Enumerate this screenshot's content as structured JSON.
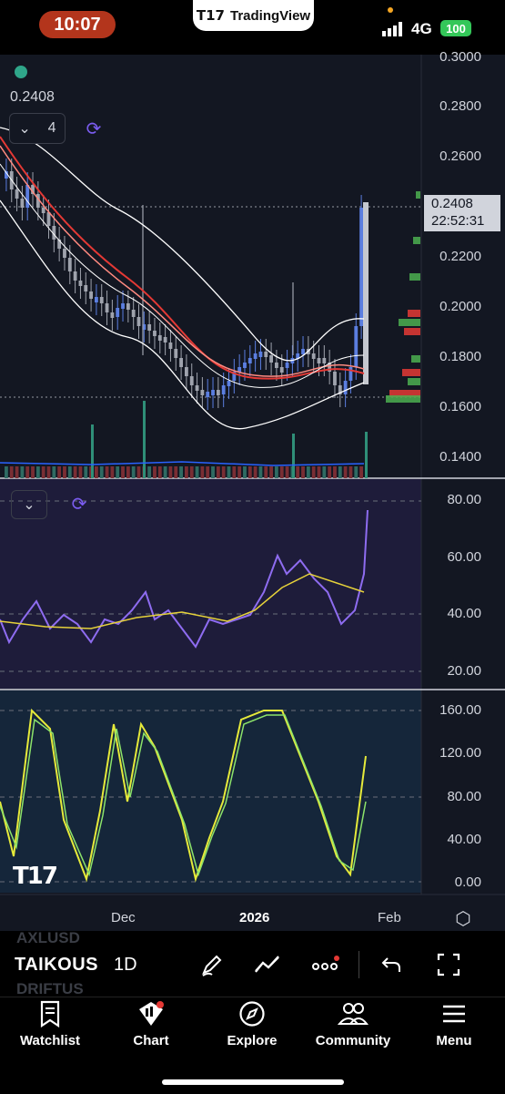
{
  "status": {
    "time": "10:07",
    "network": "4G",
    "battery": "100",
    "app_label": "TradingView"
  },
  "legend": {
    "last_price": "0.2408",
    "collapse_count": "4"
  },
  "price_axis": {
    "labels": [
      "0.3000",
      "0.2800",
      "0.2600",
      "0.2400",
      "0.2200",
      "0.2000",
      "0.1800",
      "0.1600",
      "0.1400"
    ]
  },
  "price_tag": {
    "price": "0.2408",
    "countdown": "22:52:31"
  },
  "rsi_axis": {
    "labels": [
      "80.00",
      "60.00",
      "40.00",
      "20.00"
    ]
  },
  "osc_axis": {
    "labels": [
      "160.00",
      "120.00",
      "80.00",
      "40.00",
      "0.00"
    ]
  },
  "time_axis": {
    "labels": [
      "Dec",
      "2026",
      "Feb"
    ]
  },
  "toolbar": {
    "symbol": "TAIKOUS",
    "symbol_prev": "AXLUSD",
    "symbol_next": "DRIFTUS",
    "interval": "1D"
  },
  "tabs": [
    {
      "label": "Watchlist",
      "icon": "watchlist-icon"
    },
    {
      "label": "Chart",
      "icon": "chart-icon"
    },
    {
      "label": "Explore",
      "icon": "compass-icon"
    },
    {
      "label": "Community",
      "icon": "community-icon"
    },
    {
      "label": "Menu",
      "icon": "menu-icon"
    }
  ],
  "colors": {
    "background": "#131722",
    "up": "#5b7ee0",
    "down": "#9fa3ad",
    "ema_red": "#e53935",
    "bollinger": "#ffffff",
    "rsi": "#8e6cf0",
    "rsi_ma": "#e6d23a",
    "stoch_k": "#e6ea3a",
    "stoch_d": "#8ce36a",
    "time_pill": "#b3351c"
  }
}
